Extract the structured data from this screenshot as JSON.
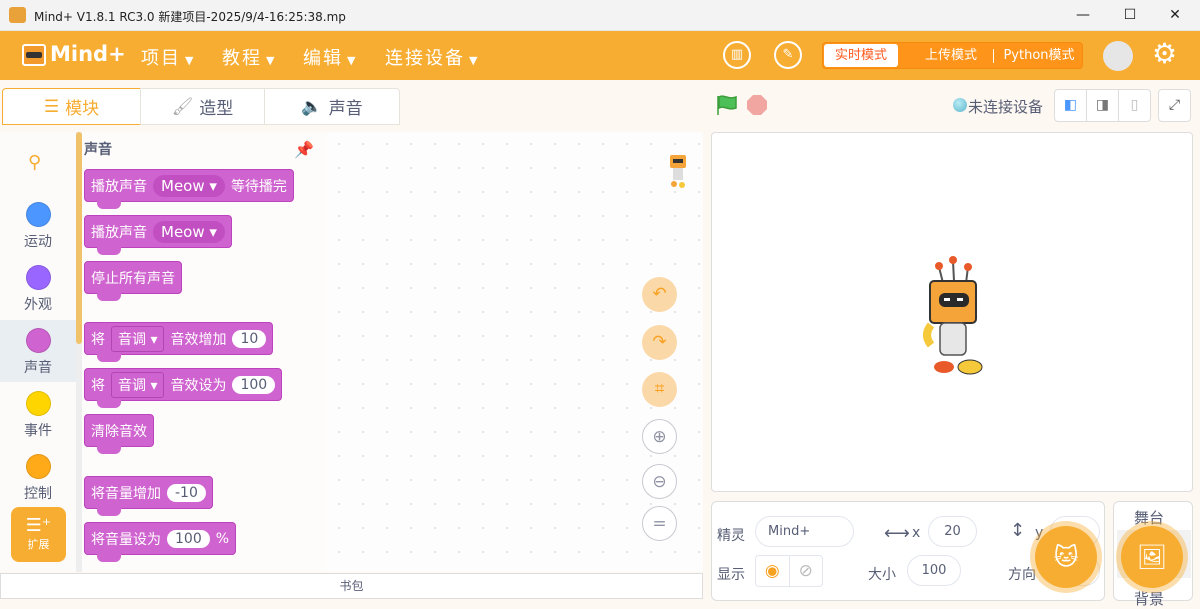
{
  "window": {
    "title": "Mind+ V1.8.1 RC3.0   新建项目-2025/9/4-16:25:38.mp",
    "minimize": "—",
    "maximize": "☐",
    "close": "✕"
  },
  "header": {
    "logo": "Mind+",
    "menus": [
      {
        "label": "项目"
      },
      {
        "label": "教程"
      },
      {
        "label": "编辑"
      },
      {
        "label": "连接设备"
      }
    ],
    "modes": [
      "实时模式",
      "上传模式",
      "Python模式"
    ],
    "active_mode": "实时模式",
    "accent": "#f7ad31"
  },
  "tabs": [
    {
      "label": "模块",
      "icon": "blocks-icon",
      "active": true
    },
    {
      "label": "造型",
      "icon": "brush-icon"
    },
    {
      "label": "声音",
      "icon": "speaker-icon"
    }
  ],
  "device_status": "未连接设备",
  "categories": [
    {
      "label": "运动",
      "color": "#4c97ff"
    },
    {
      "label": "外观",
      "color": "#9966ff"
    },
    {
      "label": "声音",
      "color": "#cf63cf",
      "active": true
    },
    {
      "label": "事件",
      "color": "#ffd500"
    },
    {
      "label": "控制",
      "color": "#ffab19"
    }
  ],
  "extension_label": "扩展",
  "palette": {
    "title": "声音",
    "blocks": [
      {
        "parts": [
          {
            "t": "播放声音"
          },
          {
            "dd": "Meow"
          },
          {
            "t": "等待播完"
          }
        ]
      },
      {
        "parts": [
          {
            "t": "播放声音"
          },
          {
            "dd": "Meow"
          }
        ]
      },
      {
        "parts": [
          {
            "t": "停止所有声音"
          }
        ]
      },
      {
        "parts": [
          {
            "t": "将"
          },
          {
            "dd2": "音调"
          },
          {
            "t": "音效增加"
          },
          {
            "n": "10"
          }
        ]
      },
      {
        "parts": [
          {
            "t": "将"
          },
          {
            "dd2": "音调"
          },
          {
            "t": "音效设为"
          },
          {
            "n": "100"
          }
        ]
      },
      {
        "parts": [
          {
            "t": "清除音效"
          }
        ]
      },
      {
        "parts": [
          {
            "t": "将音量增加"
          },
          {
            "n": "-10"
          }
        ]
      },
      {
        "parts": [
          {
            "t": "将音量设为"
          },
          {
            "n": "100"
          },
          {
            "t": "%"
          }
        ]
      }
    ]
  },
  "backpack_label": "书包",
  "sprite_info": {
    "sprite_label": "精灵",
    "sprite_name": "Mind+",
    "x_label": "x",
    "x": "20",
    "y_label": "y",
    "show_label": "显示",
    "size_label": "大小",
    "size": "100",
    "direction_label": "方向"
  },
  "stage_panel": {
    "title": "舞台",
    "backdrop_label": "背景"
  }
}
